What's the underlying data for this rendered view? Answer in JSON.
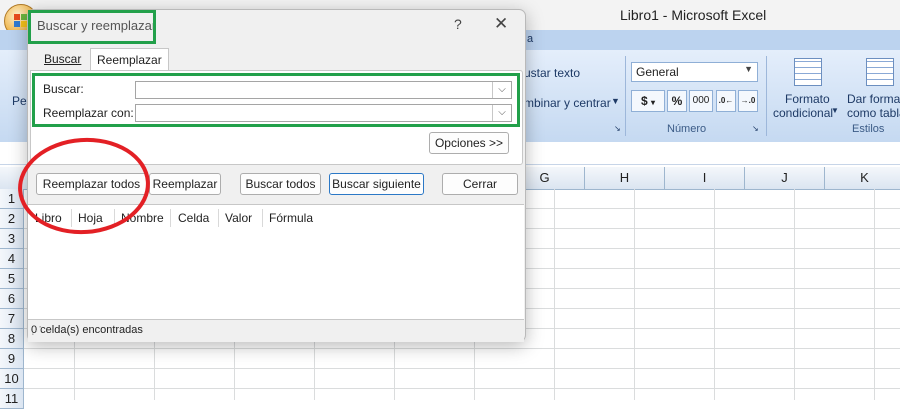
{
  "app": {
    "title": "Libro1 - Microsoft Excel",
    "ribbon_tab": "a",
    "ribbon": {
      "wrap_text": "ustar texto",
      "merge_center": "mbinar y centrar",
      "number_format": "General",
      "btn_currency": "$",
      "btn_percent": "%",
      "btn_thousands": "000",
      "number_group": "Número",
      "conditional_format_1": "Formato",
      "conditional_format_2": "condicional",
      "table_format_1": "Dar format",
      "table_format_2": "como tabla",
      "styles_group": "Estilos",
      "left_partial": "Peg"
    },
    "columns": [
      "G",
      "H",
      "I",
      "J",
      "K"
    ],
    "rows": [
      "1",
      "2",
      "3",
      "4",
      "5",
      "6",
      "7",
      "8",
      "9",
      "10",
      "11"
    ]
  },
  "dialog": {
    "title": "Buscar y reemplazar",
    "help": "?",
    "close": "✕",
    "tabs": [
      "Buscar",
      "Reemplazar"
    ],
    "active_tab": "Reemplazar",
    "find_label": "Buscar:",
    "find_value": "",
    "replace_label": "Reemplazar con:",
    "replace_value": "",
    "options_button": "Opciones >>",
    "buttons": {
      "replace_all": "Reemplazar todos",
      "replace": "Reemplazar",
      "find_all": "Buscar todos",
      "find_next": "Buscar siguiente",
      "close": "Cerrar"
    },
    "results_columns": [
      "Libro",
      "Hoja",
      "Nombre",
      "Celda",
      "Valor",
      "Fórmula"
    ],
    "status": "0 celda(s) encontradas"
  },
  "colors": {
    "highlight_green": "#22a04a",
    "highlight_red": "#e32025"
  }
}
